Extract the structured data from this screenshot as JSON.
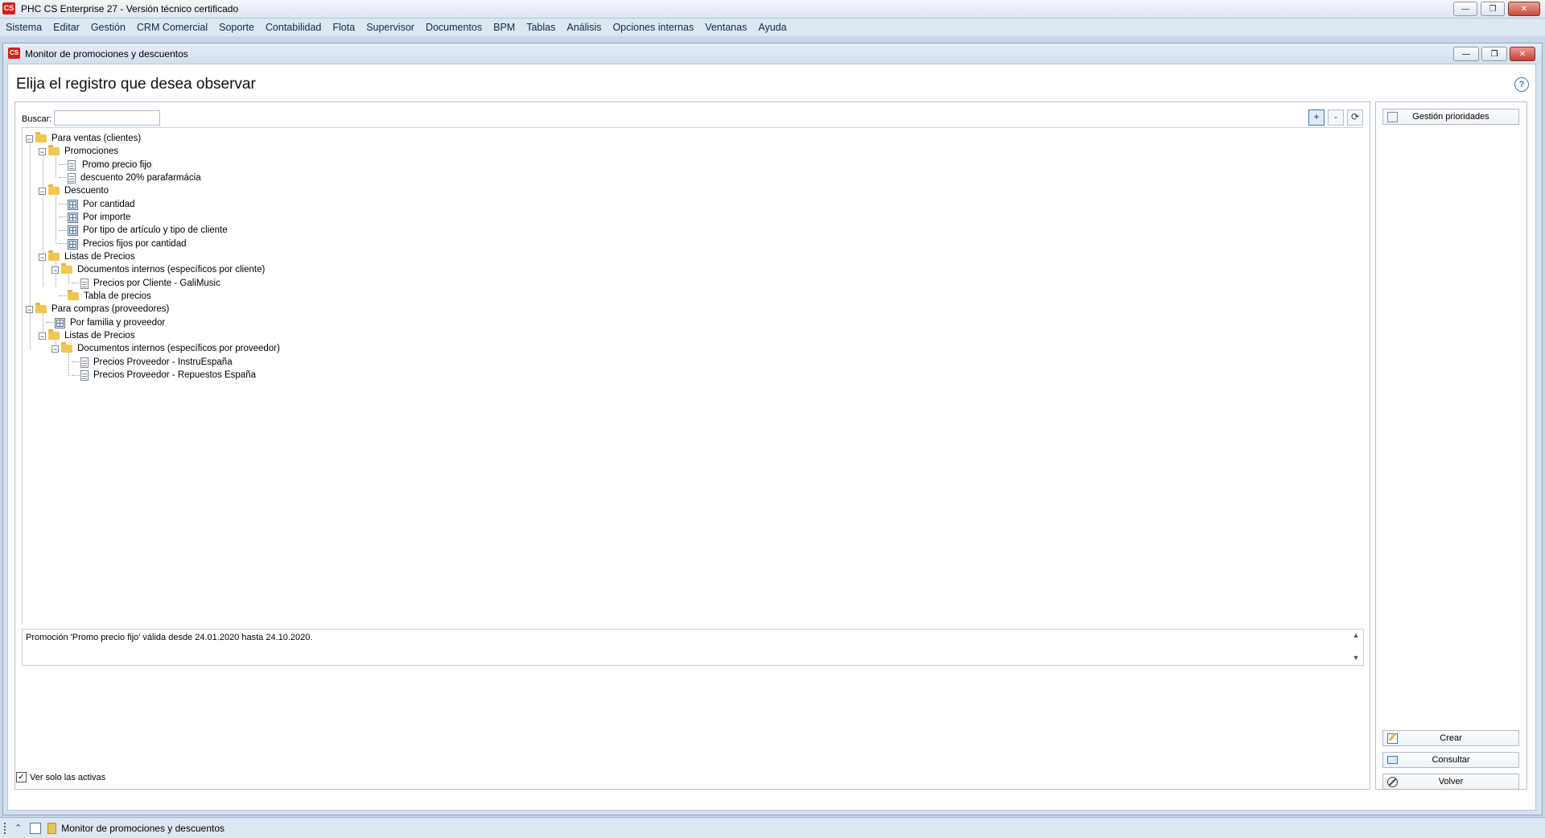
{
  "app": {
    "title": "PHC CS Enterprise 27 - Versión técnico certificado",
    "logo_text": "CS"
  },
  "menu": [
    "Sistema",
    "Editar",
    "Gestión",
    "CRM Comercial",
    "Soporte",
    "Contabilidad",
    "Flota",
    "Supervisor",
    "Documentos",
    "BPM",
    "Tablas",
    "Análisis",
    "Opciones internas",
    "Ventanas",
    "Ayuda"
  ],
  "window": {
    "title": "Monitor de promociones y descuentos",
    "logo_text": "CS",
    "header": "Elija el registro que desea observar",
    "help": "?"
  },
  "search": {
    "label": "Buscar:",
    "value": ""
  },
  "tools": {
    "expand": "+",
    "collapse": "-",
    "refresh": "⟳"
  },
  "tree": [
    {
      "label": "Para ventas (clientes)",
      "icon": "folder"
    },
    {
      "label": "Promociones",
      "icon": "folder"
    },
    {
      "label": "Promo precio fijo",
      "icon": "doc"
    },
    {
      "label": "descuento 20% parafarmácia",
      "icon": "doc"
    },
    {
      "label": "Descuento",
      "icon": "folder"
    },
    {
      "label": "Por cantidad",
      "icon": "grid"
    },
    {
      "label": "Por importe",
      "icon": "grid"
    },
    {
      "label": "Por tipo de artículo y tipo de cliente",
      "icon": "grid"
    },
    {
      "label": "Precios fijos por cantidad",
      "icon": "grid"
    },
    {
      "label": "Listas de Precios",
      "icon": "folder"
    },
    {
      "label": "Documentos internos (específicos por cliente)",
      "icon": "folder"
    },
    {
      "label": "Precios por Cliente - GaliMusic",
      "icon": "doc"
    },
    {
      "label": "Tabla de precios",
      "icon": "folder"
    },
    {
      "label": "Para compras (proveedores)",
      "icon": "folder"
    },
    {
      "label": "Por familia y proveedor",
      "icon": "grid"
    },
    {
      "label": "Listas de Precios",
      "icon": "folder"
    },
    {
      "label": "Documentos internos (específicos por proveedor)",
      "icon": "folder"
    },
    {
      "label": "Precios Proveedor - InstruEspaña",
      "icon": "doc"
    },
    {
      "label": "Precios Proveedor - Repuestos España",
      "icon": "doc"
    }
  ],
  "status": "Promoción 'Promo precio fijo' válida desde 24.01.2020 hasta 24.10.2020.",
  "filter": {
    "label": "Ver solo las activas",
    "checked": true
  },
  "side": {
    "priorities": "Gestión prioridades",
    "create": "Crear",
    "view": "Consultar",
    "back": "Volver"
  },
  "taskbar": {
    "item": "Monitor de promociones y descuentos"
  }
}
